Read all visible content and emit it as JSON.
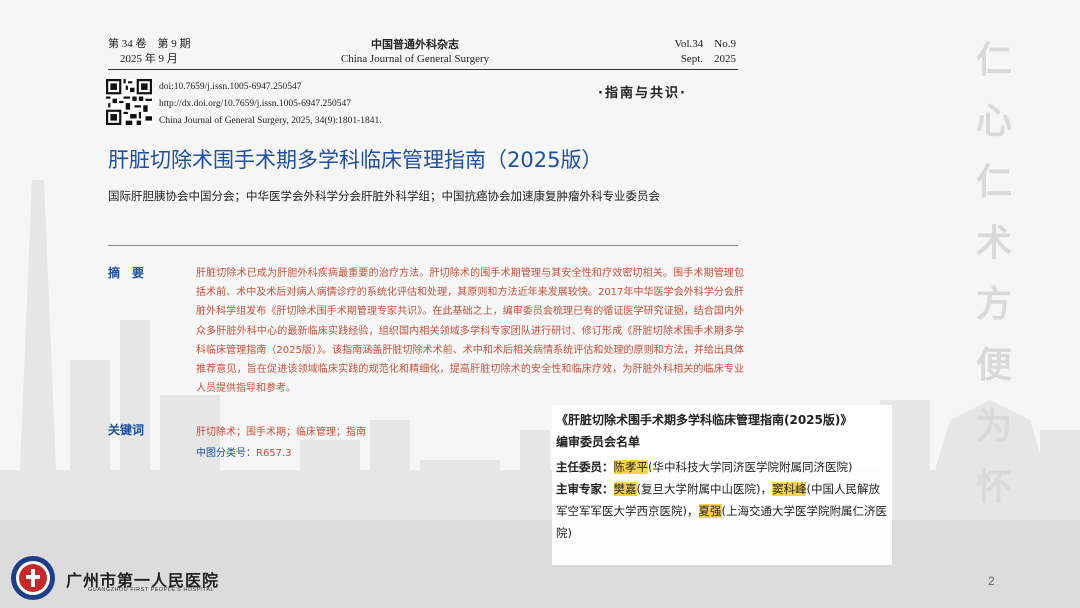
{
  "header": {
    "left_line1": "第 34 卷　第 9 期",
    "left_line2": "2025 年 9 月",
    "center_line1": "中国普通外科杂志",
    "center_line2": "China Journal of General Surgery",
    "right_line1": "Vol.34　No.9",
    "right_line2": "Sept.　2025"
  },
  "meta": {
    "doi": "doi:10.7659/j.issn.1005-6947.250547",
    "url": "http://dx.doi.org/10.7659/j.issn.1005-6947.250547",
    "citation": "China Journal of General Surgery, 2025, 34(9):1801-1841."
  },
  "section_tag": "·指南与共识·",
  "title": "肝脏切除术围手术期多学科临床管理指南（2025版）",
  "authors": "国际肝胆胰协会中国分会；中华医学会外科学分会肝脏外科学组；中国抗癌协会加速康复肿瘤外科专业委员会",
  "abstract_label": "摘　要",
  "abstract_text": "肝脏切除术已成为肝胆外科疾病最重要的治疗方法。肝切除术的围手术期管理与其安全性和疗效密切相关。围手术期管理包括术前、术中及术后对病人病情诊疗的系统化评估和处理，其原则和方法近年来发展较快。2017年中华医学会外科学分会肝脏外科学组发布《肝切除术围手术期管理专家共识》。在此基础之上，编审委员会梳理已有的循证医学研究证据，结合国内外众多肝脏外科中心的最新临床实践经验，组织国内相关领域多学科专家团队进行研讨、修订形成《肝脏切除术围手术期多学科临床管理指南（2025版）》。该指南涵盖肝脏切除术术前、术中和术后相关病情系统评估和处理的原则和方法，并给出具体推荐意见，旨在促进该领域临床实践的规范化和精细化，提高肝脏切除术的安全性和临床疗效，为肝脏外科相关的临床专业人员提供指导和参考。",
  "keywords_label": "关键词",
  "keywords_text": "肝切除术；围手术期；临床管理；指南",
  "classification_label": "中图分类号：",
  "classification_value": "R657.3",
  "committee": {
    "title": "《肝脏切除术围手术期多学科临床管理指南(2025版)》",
    "subtitle": "编审委员会名单",
    "chair_label": "主任委员：",
    "chair_name": "陈孝平",
    "chair_affil": "(华中科技大学同济医学院附属同济医院)",
    "reviewers_label": "主审专家：",
    "reviewer1_name": "樊嘉",
    "reviewer1_affil": "(复旦大学附属中山医院)，",
    "reviewer2_name": "窦科峰",
    "reviewer2_affil": "(中国人民解放军空军军医大学西京医院)，",
    "reviewer3_name": "夏强",
    "reviewer3_affil": "(上海交通大学医学院附属仁济医院)"
  },
  "side_motto": [
    "仁",
    "心",
    "仁",
    "术",
    "方",
    "便",
    "为",
    "怀"
  ],
  "hospital": {
    "name_cn": "广州市第一人民医院",
    "name_en": "GUANGZHOU FIRST PEOPLE'S HOSPITAL"
  },
  "page_number": "2"
}
